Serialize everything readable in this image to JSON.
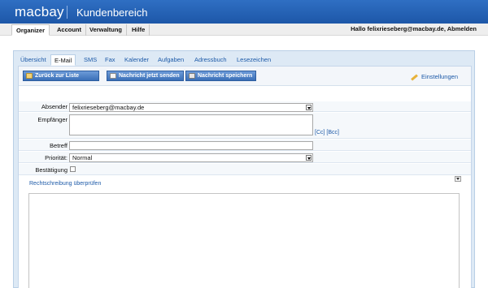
{
  "header": {
    "logo": "macbay",
    "title": "Kundenbereich"
  },
  "topnav": {
    "tabs": [
      {
        "label": "Organizer"
      },
      {
        "label": "Account"
      },
      {
        "label": "Verwaltung"
      },
      {
        "label": "Hilfe"
      }
    ],
    "greeting": "Hallo felixrieseberg@macbay.de, Abmelden"
  },
  "subtabs": [
    {
      "label": "Übersicht"
    },
    {
      "label": "E-Mail"
    },
    {
      "label": "SMS"
    },
    {
      "label": "Fax"
    },
    {
      "label": "Kalender"
    },
    {
      "label": "Aufgaben"
    },
    {
      "label": "Adressbuch"
    },
    {
      "label": "Lesezeichen"
    }
  ],
  "toolbar": {
    "back_label": "Zurück zur Liste",
    "send_label": "Nachricht jetzt senden",
    "save_label": "Nachricht speichern",
    "settings_label": "Einstellungen"
  },
  "form": {
    "sender_label": "Absender",
    "sender_value": "felixrieseberg@macbay.de",
    "recipient_label": "Empfänger",
    "recipient_value": "",
    "cc_bcc": "[Cc] [Bcc]",
    "subject_label": "Betreff",
    "subject_value": "",
    "priority_label": "Priorität:",
    "priority_value": "Normal",
    "confirmation_label": "Bestätigung",
    "confirmation_checked": false
  },
  "spellcheck_label": "Rechtschreibung überprüfen",
  "editor": {
    "body": ""
  }
}
